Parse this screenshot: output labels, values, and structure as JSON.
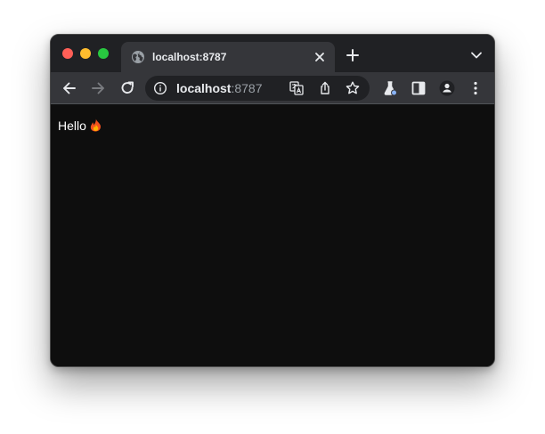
{
  "browser": {
    "tab": {
      "title": "localhost:8787",
      "favicon": "globe-icon"
    },
    "omnibox": {
      "host": "localhost",
      "port": ":8787"
    },
    "icons": {
      "back": "arrow-left-icon",
      "forward": "arrow-right-icon",
      "reload": "reload-icon",
      "info": "info-icon",
      "translate": "translate-icon",
      "share": "share-icon",
      "bookmark": "star-icon",
      "labs": "flask-icon",
      "sidepanel": "side-panel-icon",
      "profile": "person-icon",
      "menu": "kebab-menu-icon"
    },
    "colors": {
      "tabstrip": "#202124",
      "toolbar": "#35363a",
      "omnibox": "#202124",
      "page_background": "#0e0e0e",
      "close": "#ff5f57",
      "minimize": "#febc2e",
      "zoom": "#28c840"
    }
  },
  "page": {
    "text": "Hello",
    "emoji": "🔥"
  }
}
